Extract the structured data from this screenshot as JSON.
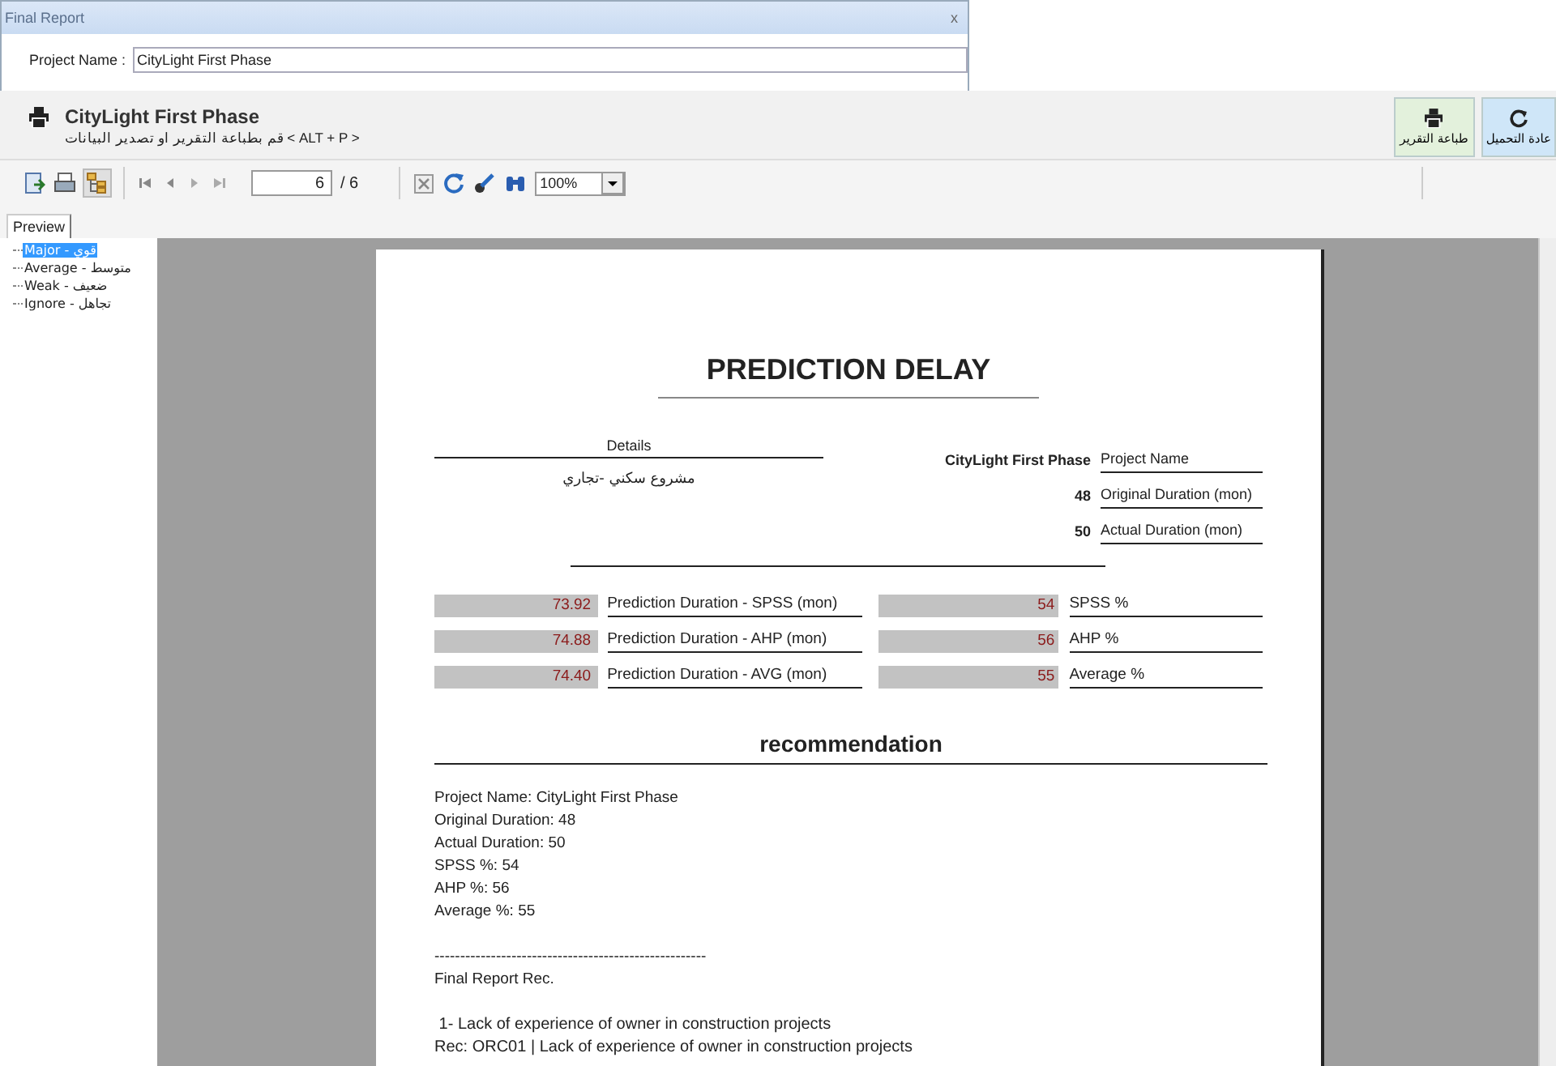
{
  "window": {
    "title": "Final Report",
    "close_glyph": "x",
    "project_label": "Project Name :",
    "project_value": "CityLight First Phase"
  },
  "ribbon": {
    "title": "CityLight First Phase",
    "subtitle": "قم بطباعة التقرير او تصدير البيانات  < ALT + P >",
    "buttons": [
      {
        "kind": "reload",
        "label": "عادة التحميل"
      },
      {
        "kind": "print",
        "label": "طباعة التقرير"
      }
    ]
  },
  "toolbar": {
    "page_value": "6",
    "page_total": "/ 6",
    "zoom": "100%"
  },
  "tabs": [
    {
      "label": "Preview",
      "selected": true
    }
  ],
  "tree": [
    {
      "label": "Major - قوي",
      "selected": true
    },
    {
      "label": "Average - متوسط",
      "selected": false
    },
    {
      "label": "Weak - ضعيف",
      "selected": false
    },
    {
      "label": "Ignore - تجاهل",
      "selected": false
    }
  ],
  "report": {
    "title": "PREDICTION DELAY",
    "details_heading": "Details",
    "details_value": "مشروع سكني -تجاري",
    "info": [
      {
        "value": "CityLight First Phase",
        "label": "Project Name"
      },
      {
        "value": "48",
        "label": "Original Duration (mon)"
      },
      {
        "value": "50",
        "label": "Actual Duration (mon)"
      }
    ],
    "metrics": [
      {
        "value": "73.92",
        "label": "Prediction Duration - SPSS (mon)",
        "pct": "54",
        "pct_label": "SPSS %"
      },
      {
        "value": "74.88",
        "label": "Prediction Duration - AHP (mon)",
        "pct": "56",
        "pct_label": "AHP %"
      },
      {
        "value": "74.40",
        "label": "Prediction Duration - AVG (mon)",
        "pct": "55",
        "pct_label": "Average %"
      }
    ],
    "recommendation_title": "recommendation",
    "summary": [
      "Project Name: CityLight First Phase",
      "Original Duration: 48",
      "Actual Duration: 50",
      "SPSS %: 54",
      "AHP %: 56",
      "Average %: 55"
    ],
    "separator": "-----------------------------------------------------",
    "rec_heading": "Final Report Rec.",
    "items": [
      " 1- Lack of experience of owner in construction projects",
      "Rec: ORC01 | Lack of experience of owner in construction projects"
    ]
  }
}
